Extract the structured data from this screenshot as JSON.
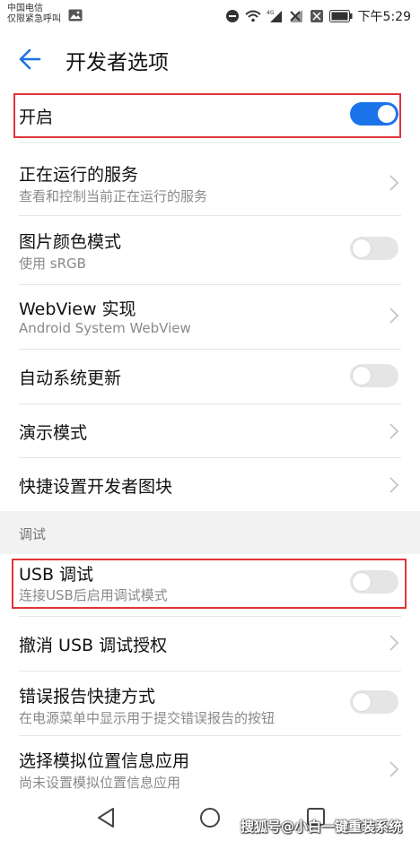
{
  "status_bar": {
    "carrier_line1": "中国电信",
    "carrier_line2": "仅限紧急呼叫",
    "network": "4G",
    "time": "下午5:29"
  },
  "header": {
    "title": "开发者选项"
  },
  "rows": [
    {
      "title": "开启",
      "control": "toggle",
      "state": "on"
    },
    {
      "title": "正在运行的服务",
      "subtitle": "查看和控制当前正在运行的服务",
      "control": "chevron"
    },
    {
      "title": "图片颜色模式",
      "subtitle": "使用 sRGB",
      "control": "toggle",
      "state": "off"
    },
    {
      "title": "WebView 实现",
      "subtitle": "Android System WebView",
      "control": "chevron"
    },
    {
      "title": "自动系统更新",
      "control": "toggle",
      "state": "off"
    },
    {
      "title": "演示模式",
      "control": "chevron"
    },
    {
      "title": "快捷设置开发者图块",
      "control": "chevron"
    }
  ],
  "section": {
    "title": "调试"
  },
  "debug_rows": [
    {
      "title": "USB 调试",
      "subtitle": "连接USB后启用调试模式",
      "control": "toggle",
      "state": "off"
    },
    {
      "title": "撤消 USB 调试授权",
      "control": "chevron"
    },
    {
      "title": "错误报告快捷方式",
      "subtitle": "在电源菜单中显示用于提交错误报告的按钮",
      "control": "toggle",
      "state": "off"
    },
    {
      "title": "选择模拟位置信息应用",
      "subtitle": "尚未设置模拟位置信息应用",
      "control": "chevron"
    }
  ],
  "watermark": "搜狐号@小白一键重装系统",
  "colors": {
    "accent": "#1a73e8",
    "highlight": "#e0343a",
    "section_bg": "#f2f2f2"
  }
}
